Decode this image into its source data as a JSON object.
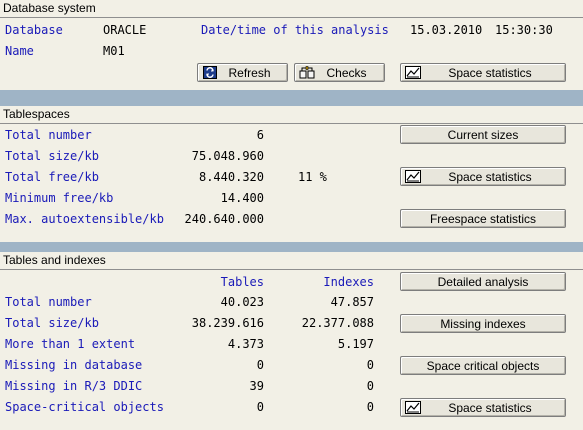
{
  "database_system": {
    "title": "Database system",
    "database_label": "Database",
    "database_value": "ORACLE",
    "name_label": "Name",
    "name_value": "M01",
    "datetime_label": "Date/time of this analysis",
    "date_value": "15.03.2010",
    "time_value": "15:30:30",
    "refresh_button": "Refresh",
    "checks_button": "Checks",
    "space_statistics_button": "Space statistics"
  },
  "tablespaces": {
    "title": "Tablespaces",
    "rows": [
      {
        "label": "Total number",
        "value": "6"
      },
      {
        "label": "Total size/kb",
        "value": "75.048.960"
      },
      {
        "label": "Total free/kb",
        "value": "8.440.320",
        "extra": "11 %"
      },
      {
        "label": "Minimum free/kb",
        "value": "14.400"
      },
      {
        "label": "Max. autoextensible/kb",
        "value": "240.640.000"
      }
    ],
    "current_sizes_button": "Current sizes",
    "space_statistics_button": "Space statistics",
    "freespace_statistics_button": "Freespace statistics"
  },
  "tables_indexes": {
    "title": "Tables and indexes",
    "col_tables": "Tables",
    "col_indexes": "Indexes",
    "rows": [
      {
        "label": "Total number",
        "tables": "40.023",
        "indexes": "47.857"
      },
      {
        "label": "Total size/kb",
        "tables": "38.239.616",
        "indexes": "22.377.088"
      },
      {
        "label": "More than 1 extent",
        "tables": "4.373",
        "indexes": "5.197"
      },
      {
        "label": "Missing in database",
        "tables": "0",
        "indexes": "0"
      },
      {
        "label": "Missing in R/3 DDIC",
        "tables": "39",
        "indexes": "0"
      },
      {
        "label": "Space-critical objects",
        "tables": "0",
        "indexes": "0"
      }
    ],
    "detailed_analysis_button": "Detailed analysis",
    "missing_indexes_button": "Missing indexes",
    "space_critical_button": "Space critical objects",
    "space_statistics_button": "Space statistics"
  },
  "icons": {
    "refresh": "refresh-icon",
    "checks": "checks-icon",
    "statistics": "statistics-chart-icon"
  },
  "colors": {
    "background": "#9fb4c6",
    "panel": "#f2f0e6",
    "label_blue": "#1a1ab8"
  }
}
